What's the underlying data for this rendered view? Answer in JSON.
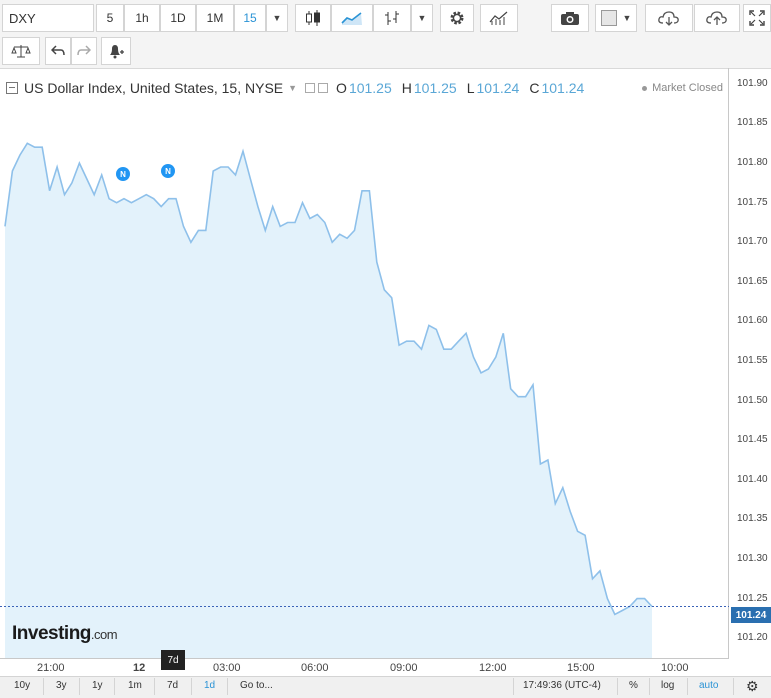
{
  "toolbar": {
    "symbol": "DXY",
    "intervals": [
      "5",
      "1h",
      "1D",
      "1M",
      "15"
    ],
    "active_interval": "15"
  },
  "legend": {
    "title": "US Dollar Index, United States, 15, NYSE",
    "o_label": "O",
    "o_value": "101.25",
    "h_label": "H",
    "h_value": "101.25",
    "l_label": "L",
    "l_value": "101.24",
    "c_label": "C",
    "c_value": "101.24"
  },
  "status": "Market Closed",
  "last_price": "101.24",
  "logo": {
    "main": "Investing",
    "suffix": ".com"
  },
  "range_tooltip": "7d",
  "bottom_bar": {
    "ranges": [
      "10y",
      "3y",
      "1y",
      "1m",
      "7d",
      "1d"
    ],
    "active_range": "1d",
    "goto": "Go to...",
    "clock": "17:49:36 (UTC-4)",
    "percent": "%",
    "log": "log",
    "auto": "auto"
  },
  "chart_data": {
    "type": "area",
    "y_ticks": [
      "101.90",
      "101.85",
      "101.80",
      "101.75",
      "101.70",
      "101.65",
      "101.60",
      "101.55",
      "101.50",
      "101.45",
      "101.40",
      "101.35",
      "101.30",
      "101.25",
      "101.20"
    ],
    "x_ticks": [
      "21:00",
      "12",
      "03:00",
      "06:00",
      "09:00",
      "12:00",
      "15:00",
      "10:00"
    ],
    "ylim": [
      101.175,
      101.915
    ],
    "grid": false,
    "colors": {
      "line": "#8ec0ea",
      "fill": "#e3f2fb",
      "last_price_line": "#3b63b8"
    },
    "news_markers": [
      "N",
      "N"
    ],
    "series": [
      {
        "values": [
          101.72,
          101.79,
          101.81,
          101.825,
          101.82,
          101.82,
          101.765,
          101.795,
          101.76,
          101.775,
          101.8,
          101.78,
          101.76,
          101.785,
          101.755,
          101.75,
          101.755,
          101.75,
          101.755,
          101.76,
          101.755,
          101.745,
          101.755,
          101.755,
          101.72,
          101.7,
          101.715,
          101.715,
          101.79,
          101.795,
          101.795,
          101.785,
          101.815,
          101.78,
          101.745,
          101.715,
          101.745,
          101.72,
          101.725,
          101.725,
          101.75,
          101.73,
          101.735,
          101.725,
          101.7,
          101.71,
          101.705,
          101.715,
          101.765,
          101.765,
          101.675,
          101.64,
          101.63,
          101.57,
          101.575,
          101.575,
          101.565,
          101.595,
          101.59,
          101.565,
          101.565,
          101.575,
          101.585,
          101.555,
          101.535,
          101.54,
          101.555,
          101.585,
          101.515,
          101.505,
          101.505,
          101.52,
          101.42,
          101.425,
          101.37,
          101.39,
          101.36,
          101.335,
          101.33,
          101.275,
          101.285,
          101.25,
          101.23,
          101.235,
          101.24,
          101.25,
          101.25,
          101.24
        ]
      }
    ]
  }
}
